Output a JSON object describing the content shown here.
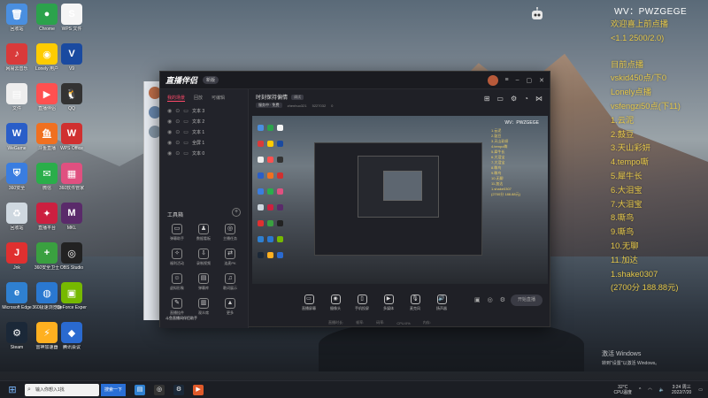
{
  "desktop": {
    "icons": [
      {
        "label": "回收站",
        "color": "#4a8fe0",
        "glyph": "🗑"
      },
      {
        "label": "Chrome",
        "color": "#2ca24c",
        "glyph": "●"
      },
      {
        "label": "WPS 文件",
        "color": "#f5f5f5",
        "glyph": "S"
      },
      {
        "label": "网易云音乐",
        "color": "#d93a3a",
        "glyph": "♪"
      },
      {
        "label": "Lonely 用户",
        "color": "#ffcc00",
        "glyph": "◉"
      },
      {
        "label": "V9",
        "color": "#1a4aa0",
        "glyph": "V"
      },
      {
        "label": "文件",
        "color": "#eeeeee",
        "glyph": "▤"
      },
      {
        "label": "直播伴侣",
        "color": "#ff5050",
        "glyph": "▶"
      },
      {
        "label": "QQ",
        "color": "#333333",
        "glyph": "🐧"
      },
      {
        "label": "WeGame",
        "color": "#2a5ec8",
        "glyph": "W"
      },
      {
        "label": "斗鱼直播",
        "color": "#f07020",
        "glyph": "鱼"
      },
      {
        "label": "WPS Office",
        "color": "#d03030",
        "glyph": "W"
      },
      {
        "label": "360安全",
        "color": "#3a7de0",
        "glyph": "⛨"
      },
      {
        "label": "微信",
        "color": "#2aae4a",
        "glyph": "✉"
      },
      {
        "label": "360软件管家",
        "color": "#e05080",
        "glyph": "▦"
      },
      {
        "label": "回收站",
        "color": "#cfd8e0",
        "glyph": "♻"
      },
      {
        "label": "直播平台",
        "color": "#cc2040",
        "glyph": "✦"
      },
      {
        "label": "MKL",
        "color": "#5a2a6a",
        "glyph": "M"
      },
      {
        "label": "Jnk",
        "color": "#e03030",
        "glyph": "J"
      },
      {
        "label": "360安全卫士",
        "color": "#3aa040",
        "glyph": "+"
      },
      {
        "label": "OBS Studio",
        "color": "#222222",
        "glyph": "◎"
      },
      {
        "label": "Microsoft Edge",
        "color": "#2f80d0",
        "glyph": "e"
      },
      {
        "label": "360极速浏览器",
        "color": "#2a78d0",
        "glyph": "◍"
      },
      {
        "label": "GeForce Experience",
        "color": "#76b900",
        "glyph": "▣"
      },
      {
        "label": "Steam",
        "color": "#1b2838",
        "glyph": "⚙"
      },
      {
        "label": "雷神加速器",
        "color": "#ffb020",
        "glyph": "⚡"
      },
      {
        "label": "腾讯会议",
        "color": "#2a6ad0",
        "glyph": "◆"
      }
    ]
  },
  "app": {
    "title": "直播伴侣",
    "version_badge": "新版",
    "left_tabs": [
      "我的场景",
      "回放",
      "可编辑"
    ],
    "scenes": [
      "文本 3",
      "文本 2",
      "文本 1",
      "全屏 1",
      "文本 0"
    ],
    "tools_title": "工具箱",
    "tools": [
      {
        "label": "弹幕助手",
        "glyph": "▭"
      },
      {
        "label": "数据看板",
        "glyph": "♟"
      },
      {
        "label": "主播任务",
        "glyph": "◎"
      },
      {
        "label": "福利活动",
        "glyph": "✧"
      },
      {
        "label": "录制视频",
        "glyph": "⇩"
      },
      {
        "label": "连麦PK",
        "glyph": "⇄"
      },
      {
        "label": "虚拟形象",
        "glyph": "☺"
      },
      {
        "label": "弹幕库",
        "glyph": "▤"
      },
      {
        "label": "歌词展示",
        "glyph": "♫"
      },
      {
        "label": "直播挂件",
        "glyph": "✎"
      },
      {
        "label": "观众席",
        "glyph": "▥"
      },
      {
        "label": "更多",
        "glyph": "▲"
      }
    ],
    "banner": "斗鱼直播间伴侣助手",
    "main_title": "时刻保持偏情",
    "main_badge": "调试",
    "sub_chip": "服务中 · 免费",
    "sub_items": [
      "zhenhuo321",
      "5227032",
      "0"
    ],
    "preview": {
      "wv": "WV：PWZGEGE",
      "list": [
        "1.云泥",
        "2.鼓豆",
        "3.天山彩妍",
        "4.tempo嘶",
        "5.犀牛长",
        "6.大泪宝",
        "7.大泪宝",
        "8.嘶鸟",
        "9.嘶鸟",
        "10.无聊",
        "11.加达",
        "1.shake0307",
        "(2700分 188.88元)"
      ]
    },
    "bottom_buttons": [
      {
        "label": "直播屏幕",
        "glyph": "▭"
      },
      {
        "label": "摄像头",
        "glyph": "◉"
      },
      {
        "label": "手机投屏",
        "glyph": "▯"
      },
      {
        "label": "多媒体",
        "glyph": "▶"
      },
      {
        "label": "麦克风",
        "glyph": "🎙"
      },
      {
        "label": "扬声器",
        "glyph": "🔊"
      }
    ],
    "live_button": "开始直播",
    "status": [
      "直播时长:",
      "帧率:",
      "码率:",
      "CPU:0%",
      "内存:"
    ]
  },
  "overlay": {
    "wv": "WV：PWZGEGE",
    "lines": [
      "欢迎喜上前点播",
      "<1.1 2500/2.0)",
      "",
      "目前点播",
      "vskid450点/下0",
      "Lonely点播",
      "vsfengzi50点(下11)",
      "1.云泥",
      "2.鼓豆",
      "3.天山彩妍",
      "4.tempo嘶",
      "5.犀牛长",
      "6.大泪宝",
      "7.大泪宝",
      "8.嘶鸟",
      "9.嘶鸟",
      "10.无聊",
      "11.加达",
      "1.shake0307",
      "(2700分 188.88元)"
    ]
  },
  "activation": {
    "title": "激活 Windows",
    "sub": "转到\"设置\"以激活 Windows。"
  },
  "taskbar": {
    "search_placeholder": "输入你想入1找",
    "search_button": "搜索一下",
    "weather_temp": "32°C",
    "weather_desc": "CPU温度",
    "time": "3:24 周三",
    "date": "2022/7/20"
  }
}
